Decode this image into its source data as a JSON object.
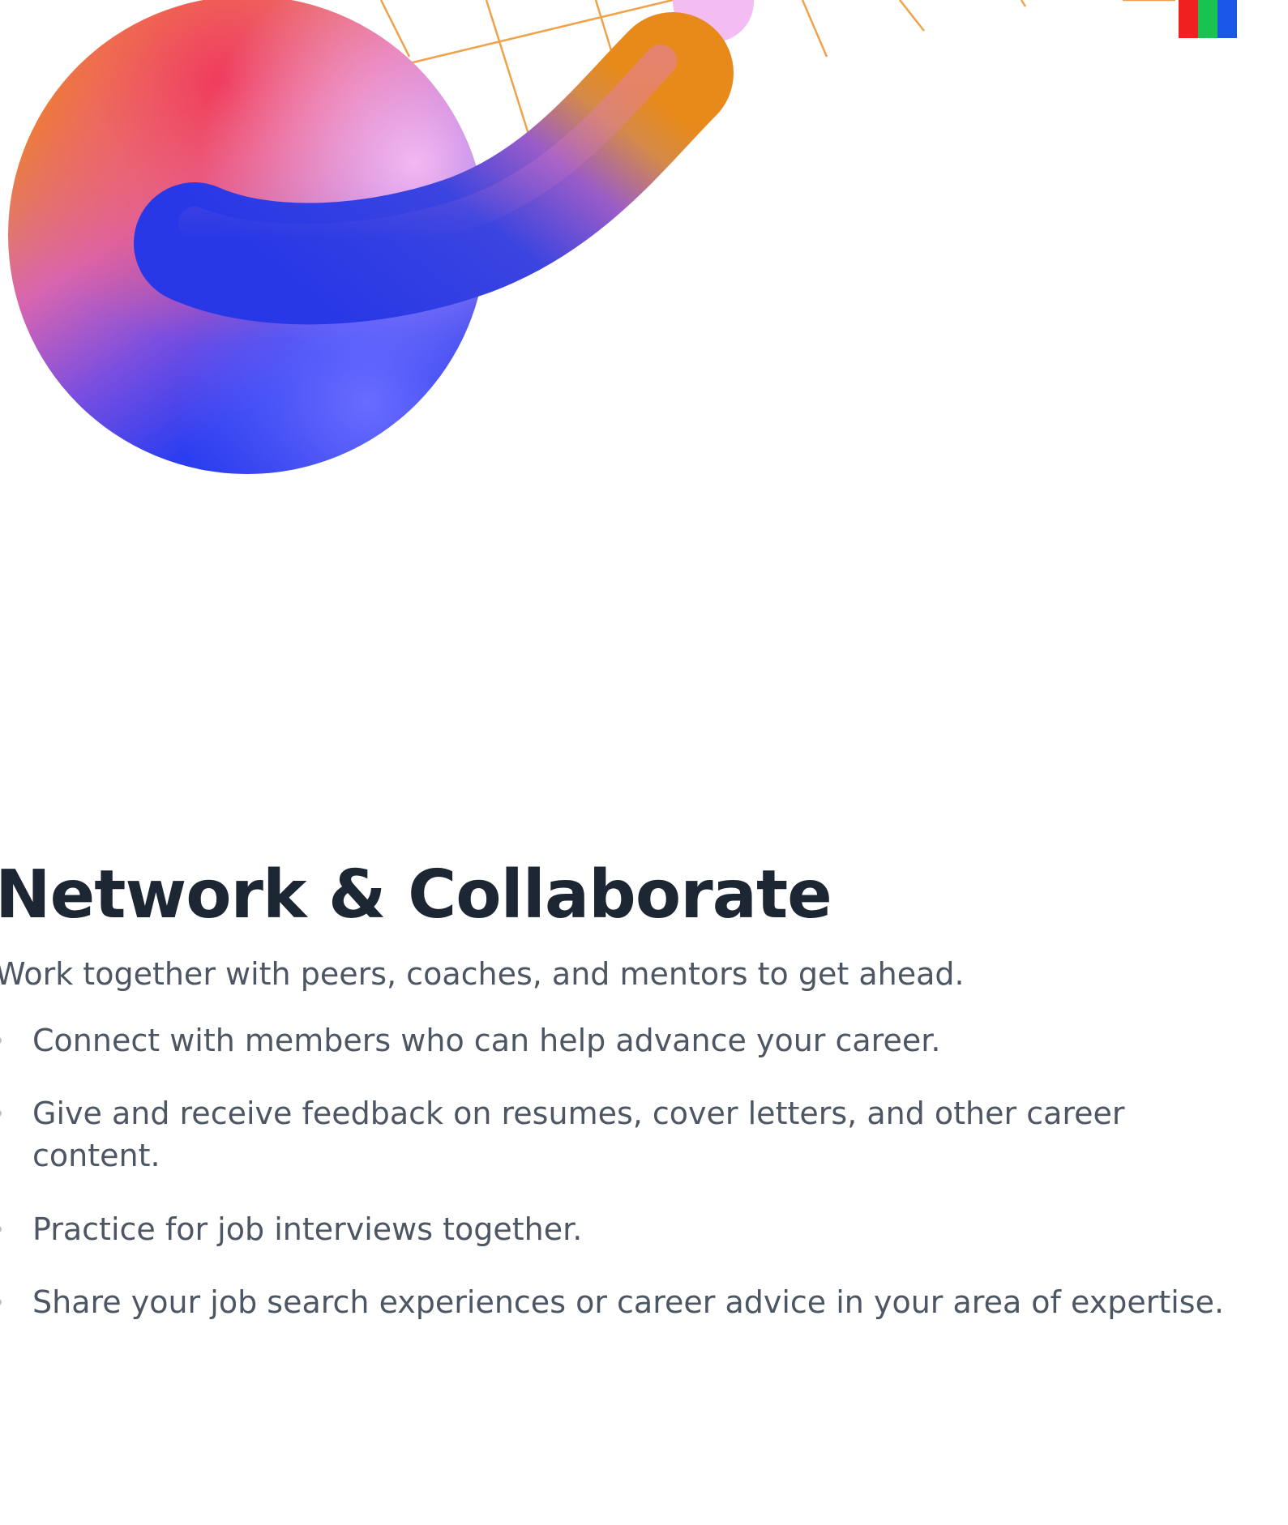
{
  "section": {
    "heading": "Network & Collaborate",
    "intro": "Work together with peers, coaches, and mentors to get ahead.",
    "bullets": [
      "Connect with members who can help advance your career.",
      "Give and receive feedback on resumes, cover letters, and other career content.",
      "Practice for job interviews together.",
      "Share your job search experiences or career advice in your area of expertise."
    ]
  },
  "colors": {
    "heading": "#1d2733",
    "body_text": "#4d5663",
    "accent_orange": "#e88a1a",
    "accent_blue": "#2a3ee6",
    "accent_pink": "#f08ac8",
    "accent_lilac": "#f0b8f0"
  }
}
